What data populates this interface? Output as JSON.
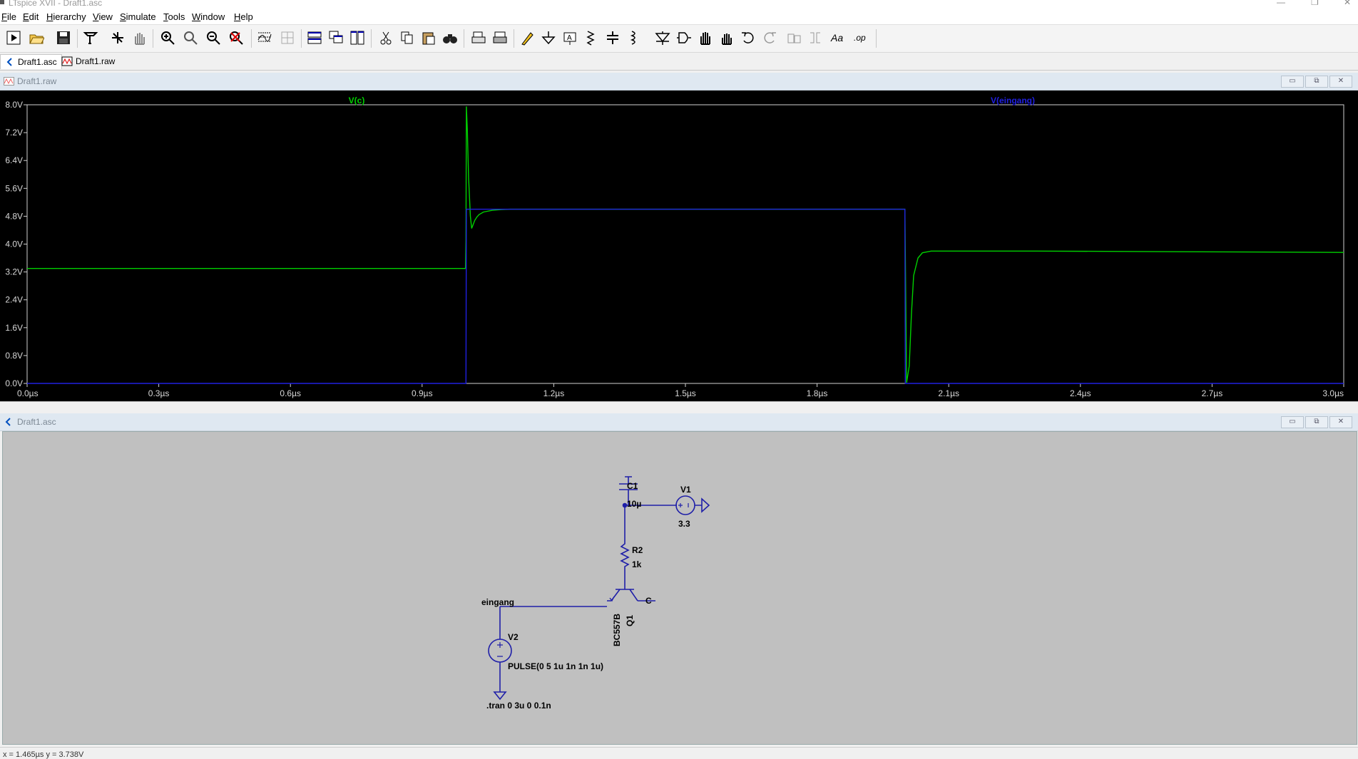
{
  "app": {
    "title": "LTspice XVII - Draft1.asc"
  },
  "menu": [
    "File",
    "Edit",
    "Hierarchy",
    "View",
    "Simulate",
    "Tools",
    "Window",
    "Help"
  ],
  "toolbar_icons": [
    "run-icon",
    "open-icon",
    "save-icon",
    "control-panel-icon",
    "halt-icon",
    "pan-hand-icon",
    "zoom-in-icon",
    "zoom-fit-icon",
    "zoom-out-icon",
    "zoom-cancel-icon",
    "autorange-icon",
    "grid-icon",
    "tile-horizontal-icon",
    "cascade-icon",
    "tile-vertical-icon",
    "cut-icon",
    "copy-icon",
    "paste-icon",
    "find-icon",
    "print-preview-icon",
    "print-icon",
    "draw-wire-icon",
    "ground-icon",
    "label-net-icon",
    "resistor-icon",
    "capacitor-icon",
    "inductor-icon",
    "diode-icon",
    "component-icon",
    "move-icon",
    "drag-icon",
    "undo-icon",
    "redo-icon",
    "rotate-icon",
    "mirror-icon",
    "text-icon",
    "spice-directive-icon"
  ],
  "tabs": [
    {
      "label": "Draft1.asc",
      "icon": "schematic-icon",
      "active": true
    },
    {
      "label": "Draft1.raw",
      "icon": "waveform-icon",
      "active": false
    }
  ],
  "plot_window": {
    "title": "Draft1.raw",
    "buttons": {
      "minimize": "▭",
      "restore": "⧉",
      "close": "✕"
    }
  },
  "schematic_window": {
    "title": "Draft1.asc",
    "buttons": {
      "minimize": "▭",
      "restore": "⧉",
      "close": "✕"
    }
  },
  "chart_data": {
    "type": "line",
    "xlabel": "",
    "ylabel": "",
    "xlim": [
      0,
      3.0
    ],
    "ylim": [
      0,
      8.0
    ],
    "x_unit": "µs",
    "x_ticks": [
      "0.0µs",
      "0.3µs",
      "0.6µs",
      "0.9µs",
      "1.2µs",
      "1.5µs",
      "1.8µs",
      "2.1µs",
      "2.4µs",
      "2.7µs",
      "3.0µs"
    ],
    "y_ticks": [
      "0.0V",
      "0.8V",
      "1.6V",
      "2.4V",
      "3.2V",
      "4.0V",
      "4.8V",
      "5.6V",
      "6.4V",
      "7.2V",
      "8.0V"
    ],
    "grid": false,
    "background": "#000000",
    "series": [
      {
        "name": "V(c)",
        "color": "#00d000",
        "x": [
          0,
          0.999,
          1.0,
          1.001,
          1.003,
          1.006,
          1.01,
          1.013,
          1.016,
          1.02,
          1.025,
          1.03,
          1.04,
          1.06,
          1.08,
          1.1,
          1.13,
          1.15,
          2.0,
          2.004,
          2.01,
          2.015,
          2.02,
          2.03,
          2.04,
          2.06,
          2.08,
          2.1,
          2.3,
          3.0
        ],
        "y": [
          3.3,
          3.3,
          4.1,
          7.95,
          7.3,
          5.9,
          4.8,
          4.45,
          4.55,
          4.68,
          4.78,
          4.85,
          4.92,
          4.97,
          4.99,
          5.0,
          5.0,
          5.0,
          5.0,
          0.02,
          0.5,
          2.0,
          3.1,
          3.6,
          3.75,
          3.8,
          3.8,
          3.8,
          3.8,
          3.76
        ]
      },
      {
        "name": "V(eingang)",
        "color": "#2020e0",
        "x": [
          0,
          0.999,
          1.0,
          1.001,
          2.0,
          2.001,
          3.0
        ],
        "y": [
          0,
          0,
          0,
          5.0,
          5.0,
          0,
          0
        ]
      }
    ]
  },
  "schematic": {
    "c1": {
      "name": "C1",
      "value": "10µ"
    },
    "v1": {
      "name": "V1",
      "value": "3.3"
    },
    "r2": {
      "name": "R2",
      "value": "1k"
    },
    "q1": {
      "name": "Q1",
      "model": "BC557B"
    },
    "v2": {
      "name": "V2",
      "value": "PULSE(0 5 1u 1n 1n 1u)"
    },
    "net_eingang": "eingang",
    "net_c": "C",
    "directive": ".tran 0 3u 0 0.1n",
    "colors": {
      "wire": "#1f1fa8",
      "background": "#c0c0c0",
      "text": "#000000"
    }
  },
  "status": {
    "text": "x = 1.465µs   y = 3.738V"
  }
}
